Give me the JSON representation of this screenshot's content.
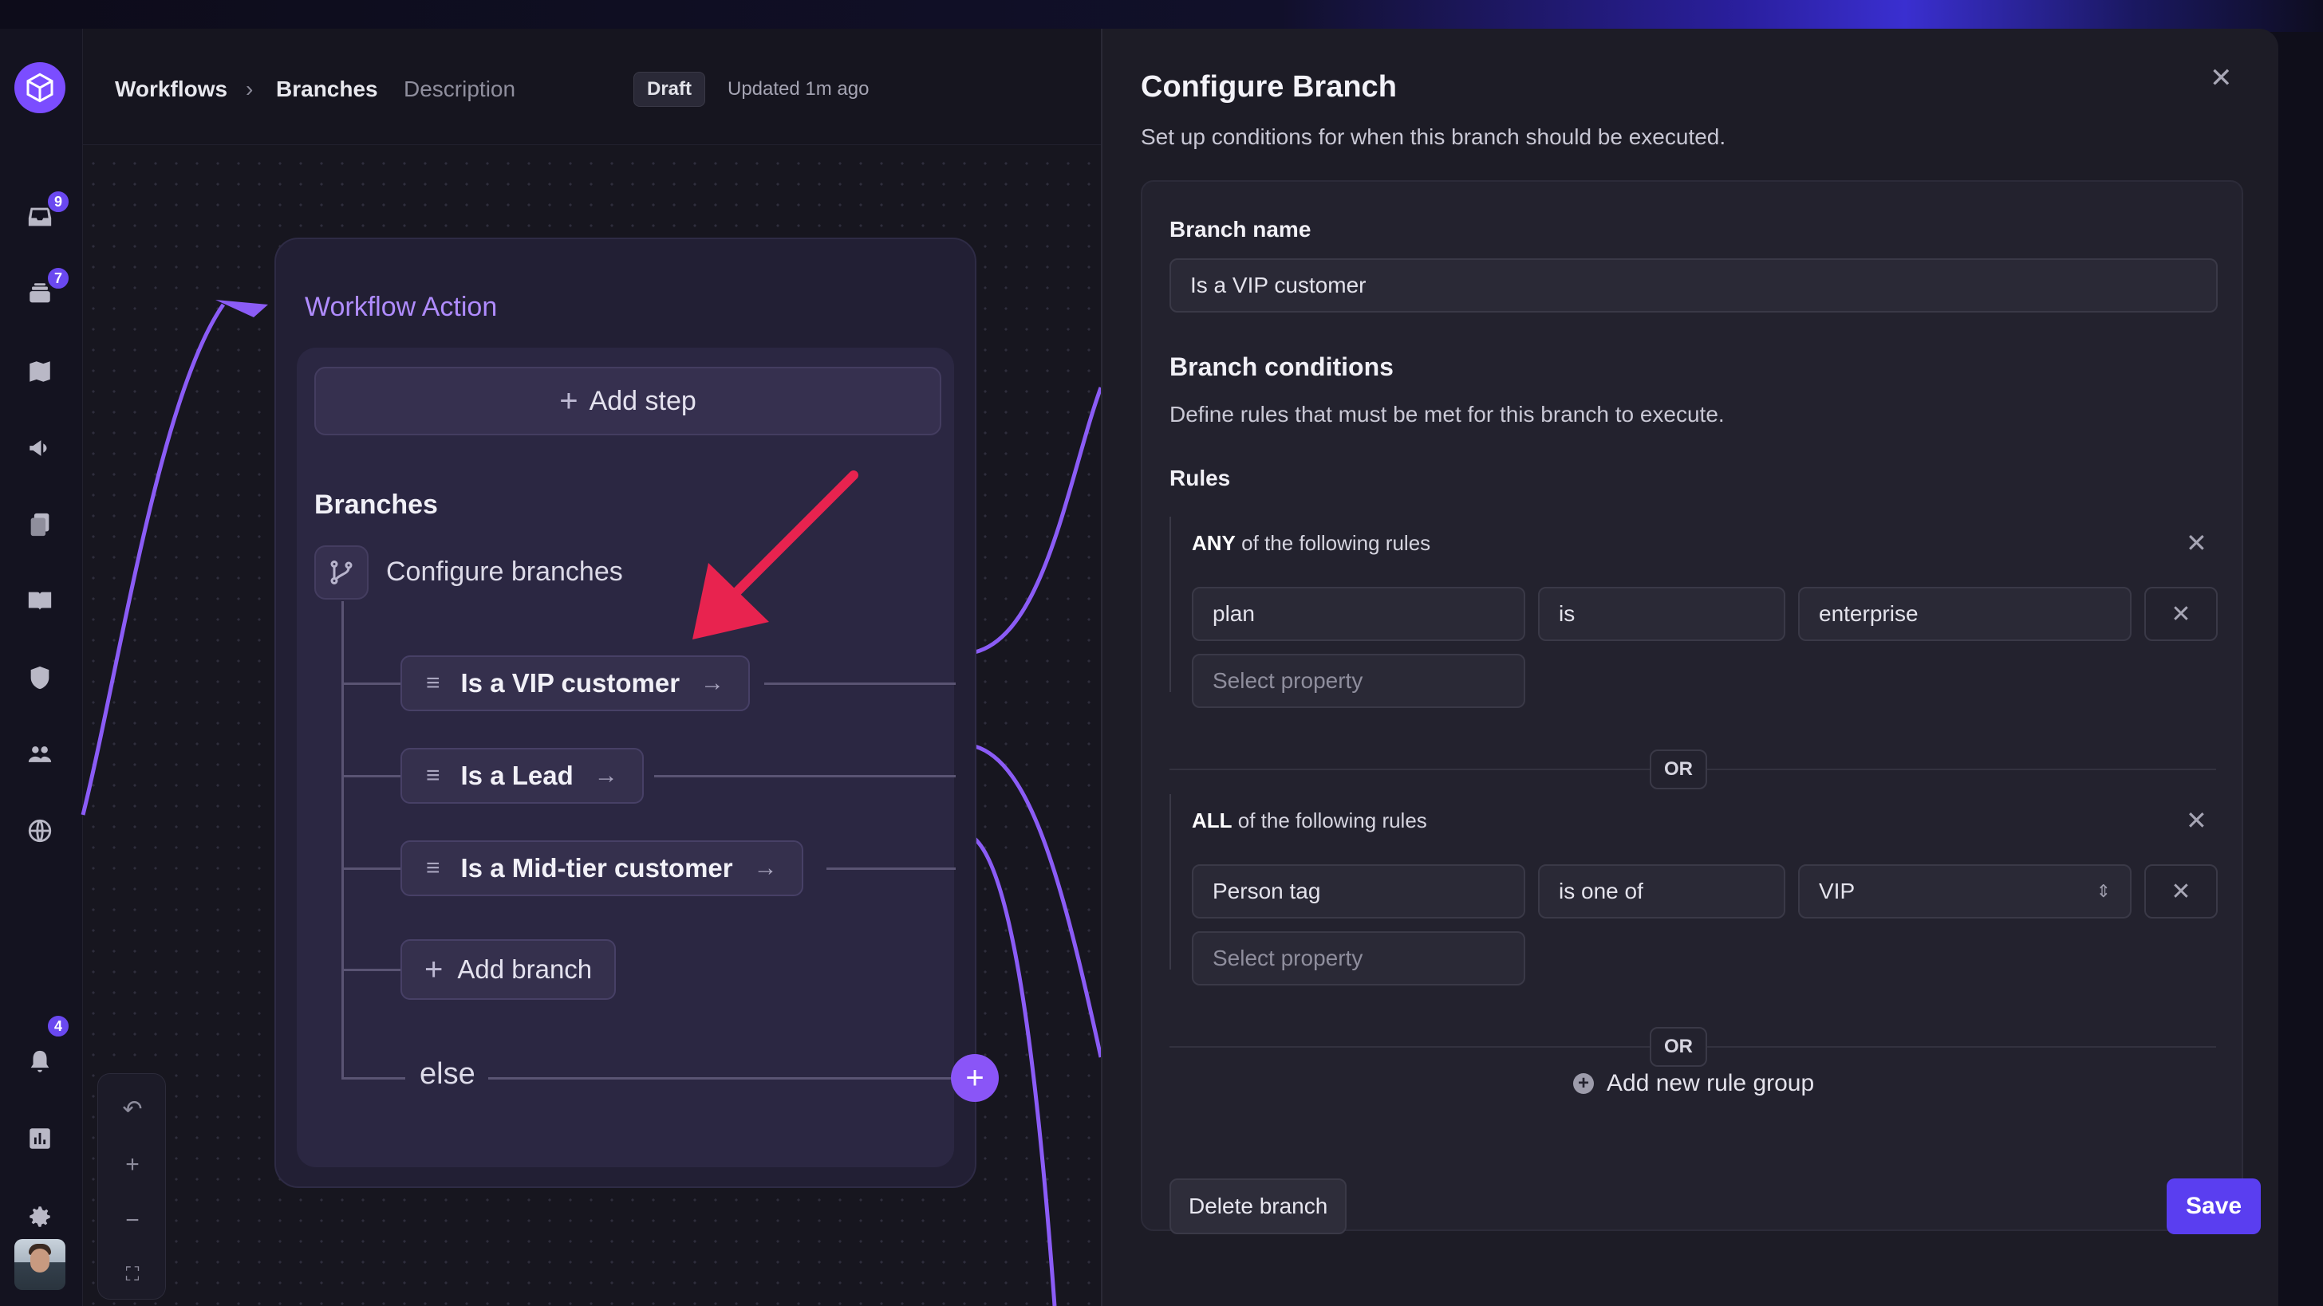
{
  "header": {
    "crumb_workflows": "Workflows",
    "crumb_sep": "›",
    "crumb_branches": "Branches",
    "tab_description": "Description",
    "status_badge": "Draft",
    "updated": "Updated 1m ago"
  },
  "sidebar": {
    "badges": {
      "inbox": "9",
      "stack": "7",
      "notifications": "4"
    },
    "icons": [
      "inbox-icon",
      "stack-icon",
      "map-icon",
      "megaphone-icon",
      "documents-icon",
      "book-icon",
      "shield-icon",
      "users-icon",
      "globe-icon",
      "bell-icon",
      "chart-icon",
      "gear-icon"
    ]
  },
  "workflow": {
    "card_title": "Workflow Action",
    "add_step": "Add step",
    "branches_title": "Branches",
    "configure_branches": "Configure branches",
    "branches": [
      "Is a VIP customer",
      "Is a Lead",
      "Is a Mid-tier customer"
    ],
    "add_branch": "Add branch",
    "else_label": "else"
  },
  "zoom_controls": {
    "undo": "↶",
    "zoom_in": "+",
    "zoom_out": "−",
    "fit": "⛶"
  },
  "panel": {
    "title": "Configure Branch",
    "subtitle": "Set up conditions for when this branch should be executed.",
    "close": "✕",
    "branch_name_label": "Branch name",
    "branch_name_value": "Is a VIP customer",
    "conditions_title": "Branch conditions",
    "conditions_desc": "Define rules that must be met for this branch to execute.",
    "rules_label": "Rules",
    "groups": [
      {
        "quantifier": "ANY",
        "suffix": " of the following rules",
        "rule": {
          "property": "plan",
          "operator": "is",
          "value": "enterprise"
        },
        "select_placeholder": "Select property"
      },
      {
        "quantifier": "ALL",
        "suffix": " of the following rules",
        "rule": {
          "property": "Person tag",
          "operator": "is one of",
          "value": "VIP"
        },
        "select_placeholder": "Select property"
      }
    ],
    "or_label": "OR",
    "add_rule_group": "Add new rule group",
    "delete_branch": "Delete branch",
    "save": "Save"
  },
  "colors": {
    "accent": "#7b4dff",
    "save_button": "#5a3ef0",
    "wire": "#8b5cf6",
    "annotation_arrow": "#e8234f"
  }
}
